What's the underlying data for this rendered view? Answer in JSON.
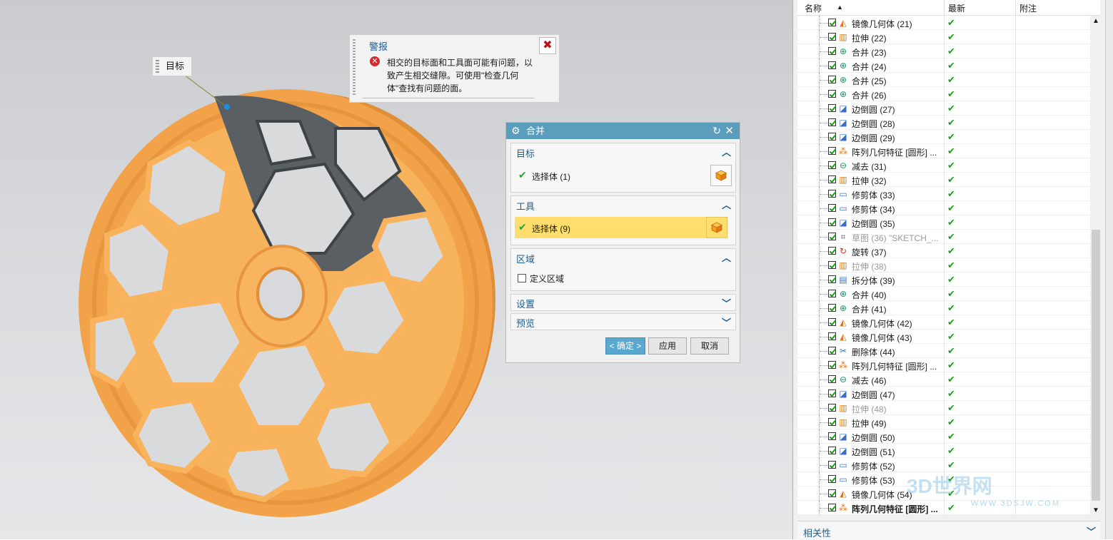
{
  "viewport": {
    "target_tag": "目标"
  },
  "alert": {
    "title": "警报",
    "message": "相交的目标面和工具面可能有问题，以致产生相交缝隙。可使用\"检查几何体\"查找有问题的面。",
    "close_label": "✖"
  },
  "dialog": {
    "title": "合并",
    "sections": {
      "target": {
        "title": "目标",
        "selection": "选择体 (1)"
      },
      "tool": {
        "title": "工具",
        "selection": "选择体 (9)"
      },
      "region": {
        "title": "区域",
        "checkbox_label": "定义区域"
      },
      "settings": {
        "title": "设置"
      },
      "preview": {
        "title": "预览"
      }
    },
    "buttons": {
      "ok": "< 确定 >",
      "apply": "应用",
      "cancel": "取消"
    }
  },
  "navigator": {
    "columns": {
      "name": "名称",
      "latest": "最新",
      "note": "附注"
    },
    "rows": [
      {
        "icon": "mirror-icon",
        "name": "镜像几何体 (21)"
      },
      {
        "icon": "extrude-icon",
        "name": "拉伸 (22)"
      },
      {
        "icon": "unite-icon",
        "name": "合并 (23)"
      },
      {
        "icon": "unite-icon",
        "name": "合并 (24)"
      },
      {
        "icon": "unite-icon",
        "name": "合并 (25)"
      },
      {
        "icon": "unite-icon",
        "name": "合并 (26)"
      },
      {
        "icon": "blend-icon",
        "name": "边倒圆 (27)"
      },
      {
        "icon": "blend-icon",
        "name": "边倒圆 (28)"
      },
      {
        "icon": "blend-icon",
        "name": "边倒圆 (29)"
      },
      {
        "icon": "pattern-icon",
        "name": "阵列几何特征 [圆形] ..."
      },
      {
        "icon": "subtract-icon",
        "name": "减去 (31)"
      },
      {
        "icon": "extrude-icon",
        "name": "拉伸 (32)"
      },
      {
        "icon": "trim-icon",
        "name": "修剪体 (33)"
      },
      {
        "icon": "trim-icon",
        "name": "修剪体 (34)"
      },
      {
        "icon": "blend-icon",
        "name": "边倒圆 (35)"
      },
      {
        "icon": "sketch-icon",
        "name": "草图 (36) \"SKETCH_...",
        "dim": true
      },
      {
        "icon": "revolve-icon",
        "name": "旋转 (37)"
      },
      {
        "icon": "extrude-icon",
        "name": "拉伸 (38)",
        "dim": true
      },
      {
        "icon": "split-icon",
        "name": "拆分体 (39)"
      },
      {
        "icon": "unite-icon",
        "name": "合并 (40)"
      },
      {
        "icon": "unite-icon",
        "name": "合并 (41)"
      },
      {
        "icon": "mirror-icon",
        "name": "镜像几何体 (42)"
      },
      {
        "icon": "mirror-icon",
        "name": "镜像几何体 (43)"
      },
      {
        "icon": "delete-body-icon",
        "name": "删除体 (44)"
      },
      {
        "icon": "pattern-icon",
        "name": "阵列几何特征 [圆形] ..."
      },
      {
        "icon": "subtract-icon",
        "name": "减去 (46)"
      },
      {
        "icon": "blend-icon",
        "name": "边倒圆 (47)"
      },
      {
        "icon": "extrude-icon",
        "name": "拉伸 (48)",
        "dim": true
      },
      {
        "icon": "extrude-icon",
        "name": "拉伸 (49)"
      },
      {
        "icon": "blend-icon",
        "name": "边倒圆 (50)"
      },
      {
        "icon": "blend-icon",
        "name": "边倒圆 (51)"
      },
      {
        "icon": "trim-icon",
        "name": "修剪体 (52)"
      },
      {
        "icon": "trim-icon",
        "name": "修剪体 (53)"
      },
      {
        "icon": "mirror-icon",
        "name": "镜像几何体 (54)"
      },
      {
        "icon": "pattern-icon",
        "name": "阵列几何特征 [圆形] ...",
        "bold": true
      }
    ],
    "latest_mark": "✔",
    "bottom_panel": "相关性"
  },
  "watermark": {
    "text": "3D世界网",
    "sub": "WWW.3DSJW.COM"
  },
  "colors": {
    "wheel": "#f2a34a",
    "tool_highlight": "#ffde6e",
    "dialog_header": "#5b9dbd"
  }
}
